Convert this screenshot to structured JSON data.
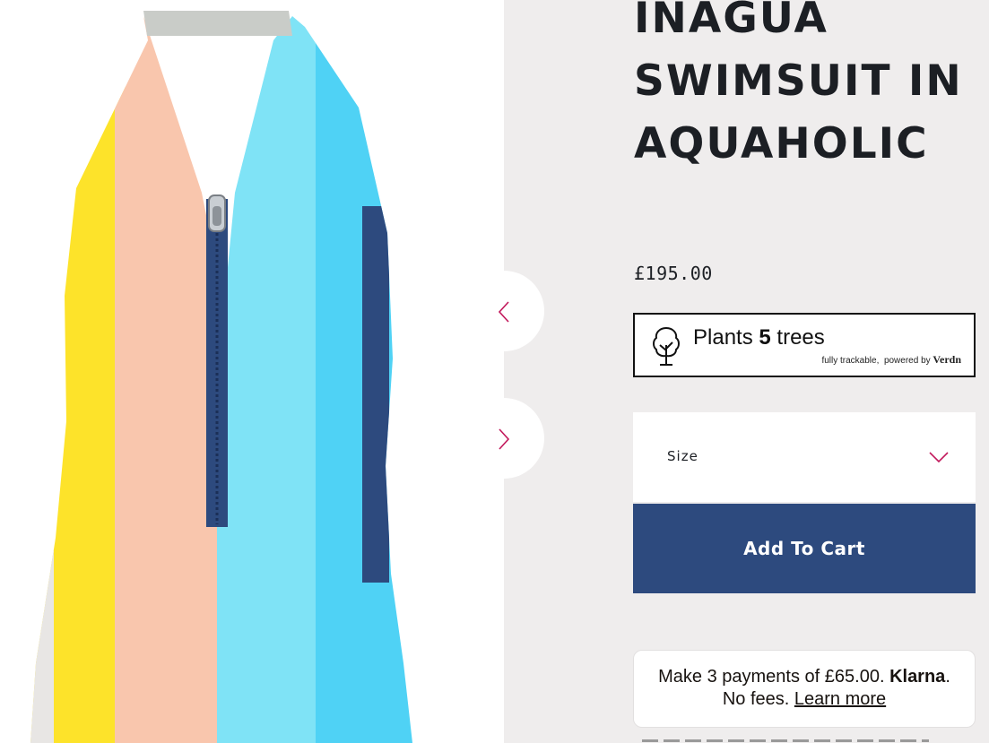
{
  "product": {
    "title": "INAGUA SWIMSUIT IN AQUAHOLIC",
    "price": "£195.00",
    "image_alt": "Striped halter swimsuit in yellow, peach, aqua and turquoise with navy front zip"
  },
  "carousel": {
    "prev_icon": "chevron-left-icon",
    "next_icon": "chevron-right-icon",
    "accent_color": "#c2185b"
  },
  "verdn": {
    "plants_prefix": "Plants",
    "tree_count": "5",
    "plants_suffix": "trees",
    "trackable_text": "fully trackable,",
    "powered_by": "powered by",
    "brand": "Verdn",
    "icon": "tree-icon"
  },
  "size": {
    "label": "Size",
    "icon": "chevron-down-icon"
  },
  "cart": {
    "button_label": "Add To Cart",
    "button_color": "#2d4a7e"
  },
  "klarna": {
    "line1_prefix": "Make 3 payments of £65.00.",
    "brand": "Klarna",
    "line1_suffix": ".",
    "line2_prefix": "No fees.",
    "learn_more": "Learn more"
  }
}
